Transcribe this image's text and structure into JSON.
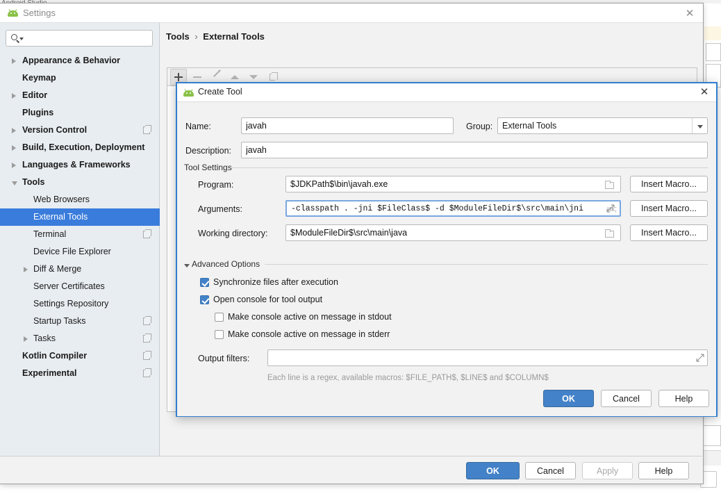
{
  "backdrop": {
    "ide_strip_text": "Android Studio"
  },
  "settings_window": {
    "title": "Settings",
    "icon": "android-icon",
    "close_icon": "close-icon",
    "search": {
      "value": "",
      "placeholder": ""
    },
    "sidebar": {
      "items": [
        {
          "label": "Appearance & Behavior",
          "level": 0,
          "arrow": "closed",
          "bold": true,
          "selected": false,
          "badge": false
        },
        {
          "label": "Keymap",
          "level": 0,
          "arrow": "none",
          "bold": true,
          "selected": false,
          "badge": false
        },
        {
          "label": "Editor",
          "level": 0,
          "arrow": "closed",
          "bold": true,
          "selected": false,
          "badge": false
        },
        {
          "label": "Plugins",
          "level": 0,
          "arrow": "none",
          "bold": true,
          "selected": false,
          "badge": false
        },
        {
          "label": "Version Control",
          "level": 0,
          "arrow": "closed",
          "bold": true,
          "selected": false,
          "badge": true
        },
        {
          "label": "Build, Execution, Deployment",
          "level": 0,
          "arrow": "closed",
          "bold": true,
          "selected": false,
          "badge": false
        },
        {
          "label": "Languages & Frameworks",
          "level": 0,
          "arrow": "closed",
          "bold": true,
          "selected": false,
          "badge": false
        },
        {
          "label": "Tools",
          "level": 0,
          "arrow": "open",
          "bold": true,
          "selected": false,
          "badge": false
        },
        {
          "label": "Web Browsers",
          "level": 1,
          "arrow": "none",
          "bold": false,
          "selected": false,
          "badge": false
        },
        {
          "label": "External Tools",
          "level": 1,
          "arrow": "none",
          "bold": false,
          "selected": true,
          "badge": false
        },
        {
          "label": "Terminal",
          "level": 1,
          "arrow": "none",
          "bold": false,
          "selected": false,
          "badge": true
        },
        {
          "label": "Device File Explorer",
          "level": 1,
          "arrow": "none",
          "bold": false,
          "selected": false,
          "badge": false
        },
        {
          "label": "Diff & Merge",
          "level": 1,
          "arrow": "closed",
          "bold": false,
          "selected": false,
          "badge": false
        },
        {
          "label": "Server Certificates",
          "level": 1,
          "arrow": "none",
          "bold": false,
          "selected": false,
          "badge": false
        },
        {
          "label": "Settings Repository",
          "level": 1,
          "arrow": "none",
          "bold": false,
          "selected": false,
          "badge": false
        },
        {
          "label": "Startup Tasks",
          "level": 1,
          "arrow": "none",
          "bold": false,
          "selected": false,
          "badge": true
        },
        {
          "label": "Tasks",
          "level": 1,
          "arrow": "closed",
          "bold": false,
          "selected": false,
          "badge": true
        },
        {
          "label": "Kotlin Compiler",
          "level": 0,
          "arrow": "none",
          "bold": true,
          "selected": false,
          "badge": true
        },
        {
          "label": "Experimental",
          "level": 0,
          "arrow": "none",
          "bold": true,
          "selected": false,
          "badge": true
        }
      ]
    },
    "main": {
      "breadcrumb": {
        "root": "Tools",
        "separator": "›",
        "leaf": "External Tools"
      },
      "toolbar": [
        {
          "icon": "add-icon",
          "enabled": true
        },
        {
          "icon": "remove-icon",
          "enabled": false
        },
        {
          "icon": "edit-pencil-icon",
          "enabled": false
        },
        {
          "icon": "move-up-icon",
          "enabled": false
        },
        {
          "icon": "move-down-icon",
          "enabled": false
        },
        {
          "icon": "copy-icon",
          "enabled": false
        }
      ]
    },
    "footer": {
      "ok": "OK",
      "cancel": "Cancel",
      "apply": "Apply",
      "help": "Help"
    }
  },
  "create_tool_dialog": {
    "title": "Create Tool",
    "icon": "android-icon",
    "close_icon": "close-icon",
    "fields": {
      "name_label": "Name:",
      "name_value": "javah",
      "group_label": "Group:",
      "group_value": "External Tools",
      "description_label": "Description:",
      "description_value": "javah"
    },
    "tool_settings": {
      "group_title": "Tool Settings",
      "program_label": "Program:",
      "program_value": "$JDKPath$\\bin\\javah.exe",
      "arguments_label": "Arguments:",
      "arguments_value": "-classpath . -jni $FileClass$ -d $ModuleFileDir$\\src\\main\\jni",
      "working_directory_label": "Working directory:",
      "working_directory_value": "$ModuleFileDir$\\src\\main\\java",
      "insert_macro_label": "Insert Macro..."
    },
    "advanced_options": {
      "group_title": "Advanced Options",
      "expanded": true,
      "checkboxes": [
        {
          "label": "Synchronize files after execution",
          "checked": true,
          "indent": 0
        },
        {
          "label": "Open console for tool output",
          "checked": true,
          "indent": 0
        },
        {
          "label": "Make console active on message in stdout",
          "checked": false,
          "indent": 1
        },
        {
          "label": "Make console active on message in stderr",
          "checked": false,
          "indent": 1
        }
      ],
      "output_filters_label": "Output filters:",
      "output_filters_value": "",
      "hint": "Each line is a regex, available macros: $FILE_PATH$, $LINE$ and $COLUMN$"
    },
    "footer": {
      "ok": "OK",
      "cancel": "Cancel",
      "help": "Help"
    }
  },
  "colors": {
    "accent_blue": "#4382c8",
    "selection_blue": "#3a7cdb",
    "dialog_border": "#2f7dce",
    "android_green": "#8ac249",
    "panel_bg": "#f2f2f2",
    "sidebar_bg": "#e8edf1"
  }
}
